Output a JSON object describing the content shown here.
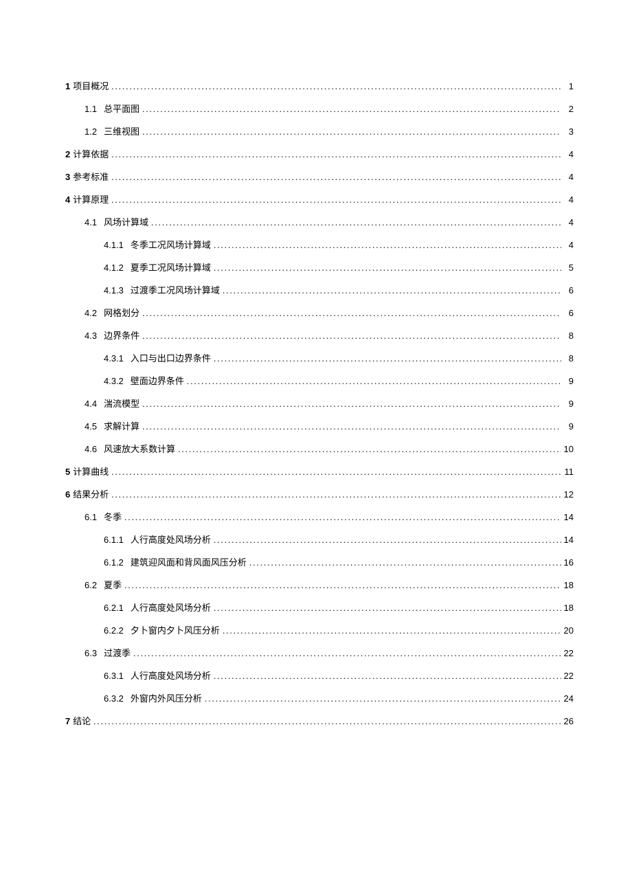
{
  "toc": [
    {
      "level": 1,
      "number": "1",
      "title": "项目概况",
      "page": "1"
    },
    {
      "level": 2,
      "number": "1.1",
      "title": "总平面图",
      "page": "2"
    },
    {
      "level": 2,
      "number": "1.2",
      "title": "三维视图",
      "page": "3"
    },
    {
      "level": 1,
      "number": "2",
      "title": "计算依据",
      "page": "4"
    },
    {
      "level": 1,
      "number": "3",
      "title": "参考标准",
      "page": "4"
    },
    {
      "level": 1,
      "number": "4",
      "title": "计算原理",
      "page": "4"
    },
    {
      "level": 2,
      "number": "4.1",
      "title": "风场计算域",
      "page": "4"
    },
    {
      "level": 3,
      "number": "4.1.1",
      "title": "冬季工况风场计算域",
      "page": "4"
    },
    {
      "level": 3,
      "number": "4.1.2",
      "title": "夏季工况风场计算域",
      "page": "5"
    },
    {
      "level": 3,
      "number": "4.1.3",
      "title": "过渡季工况风场计算域",
      "page": "6"
    },
    {
      "level": 2,
      "number": "4.2",
      "title": "网格划分",
      "page": "6"
    },
    {
      "level": 2,
      "number": "4.3",
      "title": "边界条件",
      "page": "8"
    },
    {
      "level": 3,
      "number": "4.3.1",
      "title": "入口与出口边界条件",
      "page": "8"
    },
    {
      "level": 3,
      "number": "4.3.2",
      "title": "壁面边界条件",
      "page": "9"
    },
    {
      "level": 2,
      "number": "4.4",
      "title": "湍流模型",
      "page": "9"
    },
    {
      "level": 2,
      "number": "4.5",
      "title": "求解计算",
      "page": "9"
    },
    {
      "level": 2,
      "number": "4.6",
      "title": "风速放大系数计算",
      "page": "10"
    },
    {
      "level": 1,
      "number": "5",
      "title": "计算曲线",
      "page": "11"
    },
    {
      "level": 1,
      "number": "6",
      "title": "结果分析",
      "page": "12"
    },
    {
      "level": 2,
      "number": "6.1",
      "title": "冬季",
      "page": "14"
    },
    {
      "level": 3,
      "number": "6.1.1",
      "title": "人行高度处风场分析",
      "page": "14"
    },
    {
      "level": 3,
      "number": "6.1.2",
      "title": "建筑迎风面和背风面风压分析",
      "page": "16"
    },
    {
      "level": 2,
      "number": "6.2",
      "title": "夏季",
      "page": "18"
    },
    {
      "level": 3,
      "number": "6.2.1",
      "title": "人行高度处风场分析",
      "page": "18"
    },
    {
      "level": 3,
      "number": "6.2.2",
      "title": "夕卜窗内夕卜风压分析",
      "page": "20"
    },
    {
      "level": 2,
      "number": "6.3",
      "title": "过渡季",
      "page": "22"
    },
    {
      "level": 3,
      "number": "6.3.1",
      "title": "人行高度处风场分析",
      "page": "22"
    },
    {
      "level": 3,
      "number": "6.3.2",
      "title": "外窗内外风压分析",
      "page": "24"
    },
    {
      "level": 1,
      "number": "7",
      "title": "结论",
      "page": "26"
    }
  ]
}
